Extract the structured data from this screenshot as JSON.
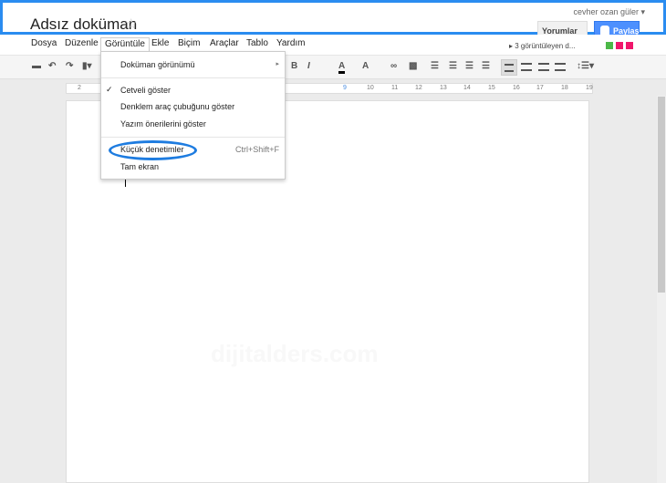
{
  "header": {
    "title": "Adsız doküman",
    "user": "cevher ozan güler ▾",
    "comments_label": "Yorumlar ▾",
    "share_label": "Paylaş"
  },
  "menubar": {
    "items": [
      "Dosya",
      "Düzenle",
      "Görüntüle",
      "Ekle",
      "Biçim",
      "Araçlar",
      "Tablo",
      "Yardım"
    ],
    "viewers": "▸ 3 görüntüleyen d...",
    "viewer_colors": [
      "#4cb848",
      "#f0166b",
      "#f0166b"
    ]
  },
  "toolbar": {
    "bold": "B",
    "italic": "I",
    "text_color": "A",
    "highlight": "A"
  },
  "ruler": [
    "2",
    "9",
    "10",
    "11",
    "12",
    "13",
    "14",
    "15",
    "16",
    "17",
    "18",
    "19"
  ],
  "view_menu": {
    "items": [
      {
        "label": "Doküman görünümü",
        "submenu": "▸"
      },
      {
        "label": "Cetveli göster",
        "checked": "✓"
      },
      {
        "label": "Denklem araç çubuğunu göster"
      },
      {
        "label": "Yazım önerilerini göster"
      },
      {
        "label": "Küçük denetimler",
        "shortcut": "Ctrl+Shift+F",
        "highlighted": true
      },
      {
        "label": "Tam ekran"
      }
    ]
  },
  "watermark": "dijitalders.com",
  "accent": "#2a8cf0"
}
